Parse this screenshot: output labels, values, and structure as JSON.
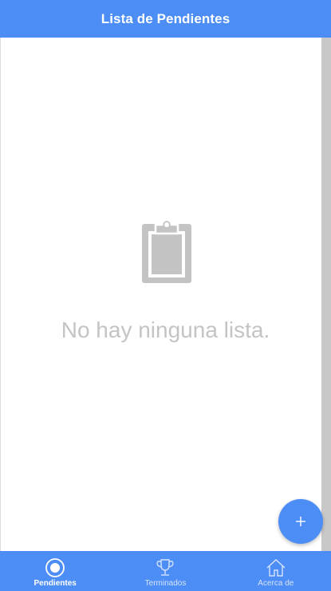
{
  "header": {
    "title": "Lista de Pendientes"
  },
  "empty_state": {
    "icon": "clipboard-icon",
    "message": "No hay ninguna lista."
  },
  "fab": {
    "icon": "add-icon",
    "label": "+"
  },
  "tabs": [
    {
      "label": "Pendientes",
      "icon": "radio-button-icon",
      "active": true
    },
    {
      "label": "Terminados",
      "icon": "trophy-icon",
      "active": false
    },
    {
      "label": "Acerca de",
      "icon": "home-icon",
      "active": false
    }
  ],
  "colors": {
    "primary": "#4d8df6",
    "empty_gray": "#c4c4c4",
    "scrollbar": "#c8c8c8"
  }
}
